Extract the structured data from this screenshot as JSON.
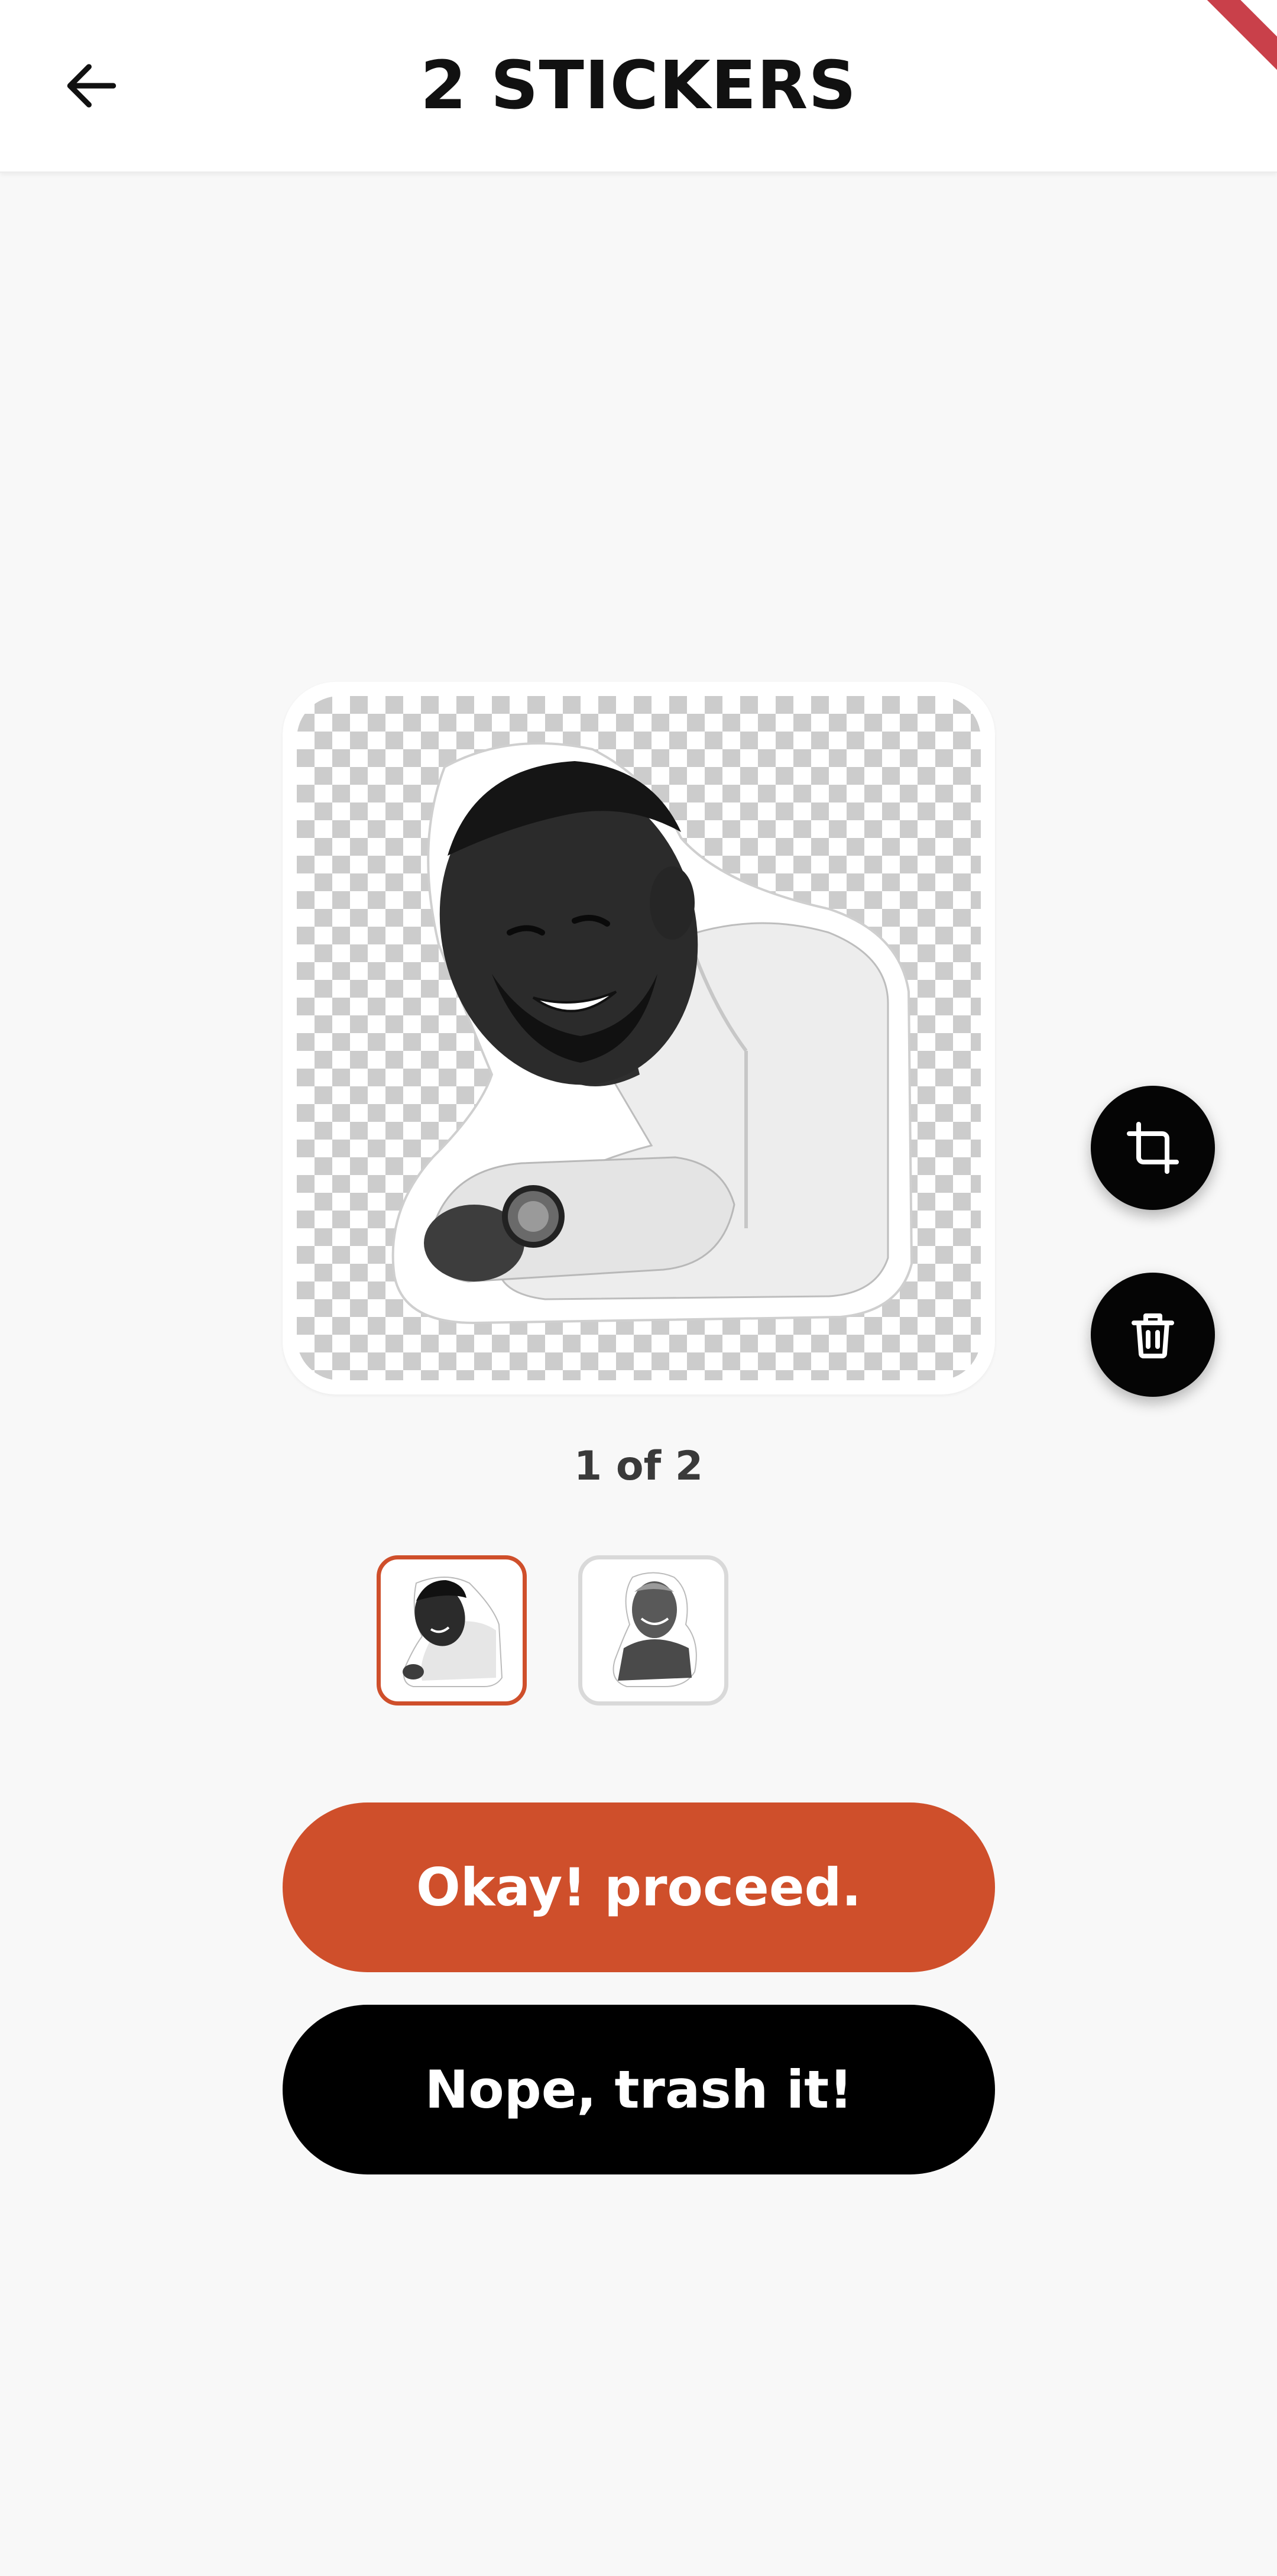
{
  "app_bar": {
    "title": "2 STICKERS",
    "back_icon": "arrow-left-icon"
  },
  "preview": {
    "current": 1,
    "total": 2,
    "counter_text": "1 of 2"
  },
  "actions": {
    "crop_icon": "crop-icon",
    "delete_icon": "trash-icon"
  },
  "thumbnails": [
    {
      "index": 1,
      "selected": true
    },
    {
      "index": 2,
      "selected": false
    }
  ],
  "buttons": {
    "proceed_label": "Okay! proceed.",
    "trash_label": "Nope, trash it!"
  },
  "colors": {
    "accent": "#cf4f2b",
    "dark": "#000000",
    "background": "#f8f8f8"
  }
}
